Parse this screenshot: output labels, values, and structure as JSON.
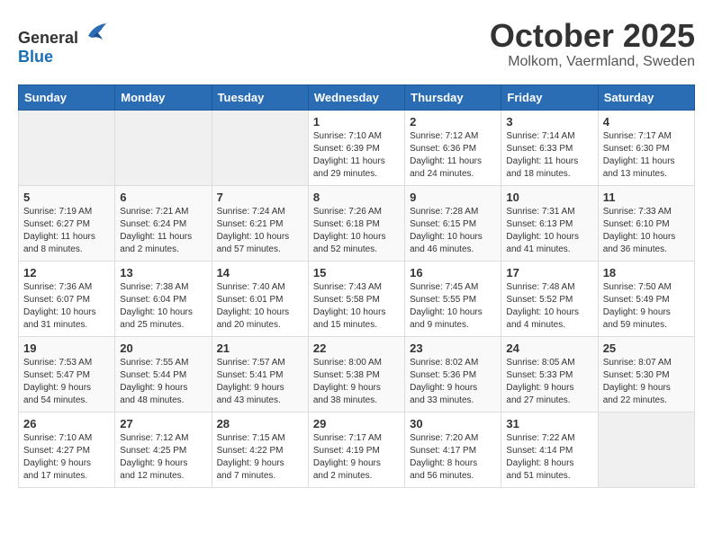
{
  "header": {
    "logo_general": "General",
    "logo_blue": "Blue",
    "month": "October 2025",
    "location": "Molkom, Vaermland, Sweden"
  },
  "weekdays": [
    "Sunday",
    "Monday",
    "Tuesday",
    "Wednesday",
    "Thursday",
    "Friday",
    "Saturday"
  ],
  "weeks": [
    [
      {
        "day": "",
        "info": ""
      },
      {
        "day": "",
        "info": ""
      },
      {
        "day": "",
        "info": ""
      },
      {
        "day": "1",
        "info": "Sunrise: 7:10 AM\nSunset: 6:39 PM\nDaylight: 11 hours\nand 29 minutes."
      },
      {
        "day": "2",
        "info": "Sunrise: 7:12 AM\nSunset: 6:36 PM\nDaylight: 11 hours\nand 24 minutes."
      },
      {
        "day": "3",
        "info": "Sunrise: 7:14 AM\nSunset: 6:33 PM\nDaylight: 11 hours\nand 18 minutes."
      },
      {
        "day": "4",
        "info": "Sunrise: 7:17 AM\nSunset: 6:30 PM\nDaylight: 11 hours\nand 13 minutes."
      }
    ],
    [
      {
        "day": "5",
        "info": "Sunrise: 7:19 AM\nSunset: 6:27 PM\nDaylight: 11 hours\nand 8 minutes."
      },
      {
        "day": "6",
        "info": "Sunrise: 7:21 AM\nSunset: 6:24 PM\nDaylight: 11 hours\nand 2 minutes."
      },
      {
        "day": "7",
        "info": "Sunrise: 7:24 AM\nSunset: 6:21 PM\nDaylight: 10 hours\nand 57 minutes."
      },
      {
        "day": "8",
        "info": "Sunrise: 7:26 AM\nSunset: 6:18 PM\nDaylight: 10 hours\nand 52 minutes."
      },
      {
        "day": "9",
        "info": "Sunrise: 7:28 AM\nSunset: 6:15 PM\nDaylight: 10 hours\nand 46 minutes."
      },
      {
        "day": "10",
        "info": "Sunrise: 7:31 AM\nSunset: 6:13 PM\nDaylight: 10 hours\nand 41 minutes."
      },
      {
        "day": "11",
        "info": "Sunrise: 7:33 AM\nSunset: 6:10 PM\nDaylight: 10 hours\nand 36 minutes."
      }
    ],
    [
      {
        "day": "12",
        "info": "Sunrise: 7:36 AM\nSunset: 6:07 PM\nDaylight: 10 hours\nand 31 minutes."
      },
      {
        "day": "13",
        "info": "Sunrise: 7:38 AM\nSunset: 6:04 PM\nDaylight: 10 hours\nand 25 minutes."
      },
      {
        "day": "14",
        "info": "Sunrise: 7:40 AM\nSunset: 6:01 PM\nDaylight: 10 hours\nand 20 minutes."
      },
      {
        "day": "15",
        "info": "Sunrise: 7:43 AM\nSunset: 5:58 PM\nDaylight: 10 hours\nand 15 minutes."
      },
      {
        "day": "16",
        "info": "Sunrise: 7:45 AM\nSunset: 5:55 PM\nDaylight: 10 hours\nand 9 minutes."
      },
      {
        "day": "17",
        "info": "Sunrise: 7:48 AM\nSunset: 5:52 PM\nDaylight: 10 hours\nand 4 minutes."
      },
      {
        "day": "18",
        "info": "Sunrise: 7:50 AM\nSunset: 5:49 PM\nDaylight: 9 hours\nand 59 minutes."
      }
    ],
    [
      {
        "day": "19",
        "info": "Sunrise: 7:53 AM\nSunset: 5:47 PM\nDaylight: 9 hours\nand 54 minutes."
      },
      {
        "day": "20",
        "info": "Sunrise: 7:55 AM\nSunset: 5:44 PM\nDaylight: 9 hours\nand 48 minutes."
      },
      {
        "day": "21",
        "info": "Sunrise: 7:57 AM\nSunset: 5:41 PM\nDaylight: 9 hours\nand 43 minutes."
      },
      {
        "day": "22",
        "info": "Sunrise: 8:00 AM\nSunset: 5:38 PM\nDaylight: 9 hours\nand 38 minutes."
      },
      {
        "day": "23",
        "info": "Sunrise: 8:02 AM\nSunset: 5:36 PM\nDaylight: 9 hours\nand 33 minutes."
      },
      {
        "day": "24",
        "info": "Sunrise: 8:05 AM\nSunset: 5:33 PM\nDaylight: 9 hours\nand 27 minutes."
      },
      {
        "day": "25",
        "info": "Sunrise: 8:07 AM\nSunset: 5:30 PM\nDaylight: 9 hours\nand 22 minutes."
      }
    ],
    [
      {
        "day": "26",
        "info": "Sunrise: 7:10 AM\nSunset: 4:27 PM\nDaylight: 9 hours\nand 17 minutes."
      },
      {
        "day": "27",
        "info": "Sunrise: 7:12 AM\nSunset: 4:25 PM\nDaylight: 9 hours\nand 12 minutes."
      },
      {
        "day": "28",
        "info": "Sunrise: 7:15 AM\nSunset: 4:22 PM\nDaylight: 9 hours\nand 7 minutes."
      },
      {
        "day": "29",
        "info": "Sunrise: 7:17 AM\nSunset: 4:19 PM\nDaylight: 9 hours\nand 2 minutes."
      },
      {
        "day": "30",
        "info": "Sunrise: 7:20 AM\nSunset: 4:17 PM\nDaylight: 8 hours\nand 56 minutes."
      },
      {
        "day": "31",
        "info": "Sunrise: 7:22 AM\nSunset: 4:14 PM\nDaylight: 8 hours\nand 51 minutes."
      },
      {
        "day": "",
        "info": ""
      }
    ]
  ]
}
